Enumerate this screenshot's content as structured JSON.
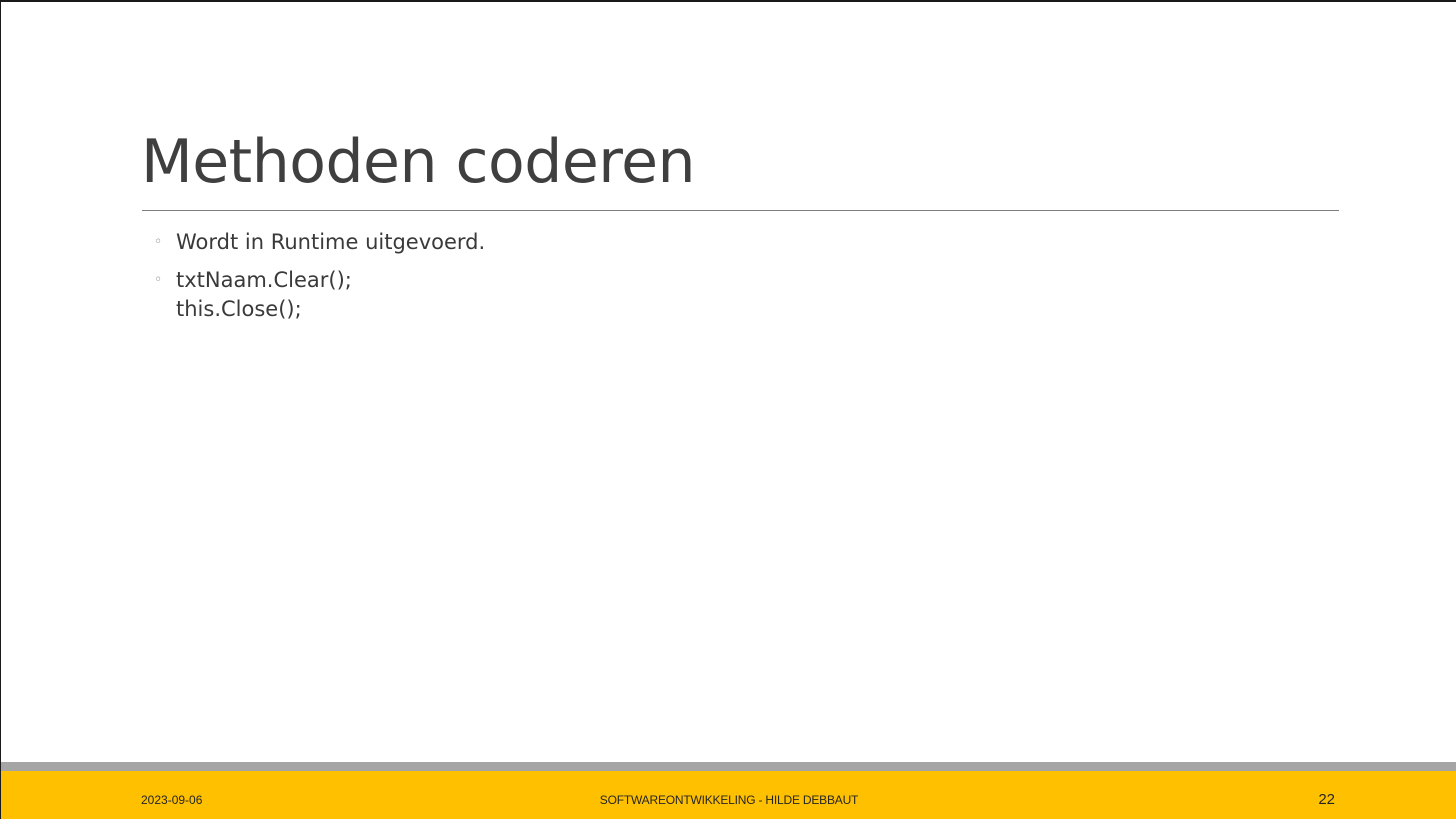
{
  "slide": {
    "title": "Methoden coderen",
    "bullets": [
      {
        "lines": [
          "Wordt in Runtime uitgevoerd."
        ]
      },
      {
        "lines": [
          "txtNaam.Clear();",
          "this.Close();"
        ]
      }
    ],
    "bullet_marker": "◦"
  },
  "footer": {
    "date": "2023-09-06",
    "center_text": "SOFTWAREONTWIKKELING - HILDE DEBBAUT",
    "page_number": "22"
  },
  "colors": {
    "title": "#3f3f3f",
    "text": "#3a3a3a",
    "accent_bar": "#ffc000",
    "gray_bar": "#a5a5a5"
  }
}
